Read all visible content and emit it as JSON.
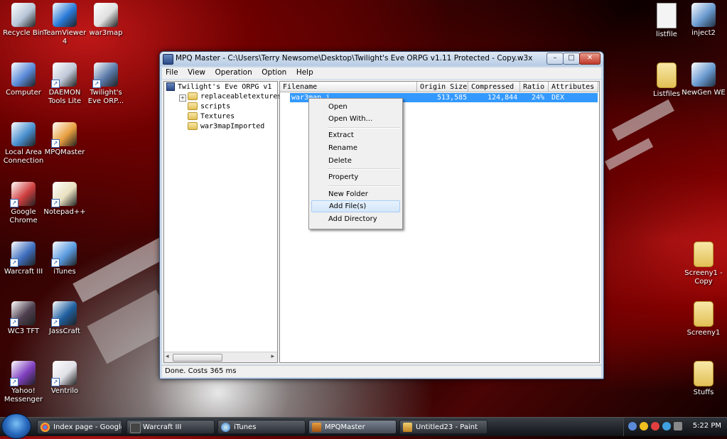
{
  "desktop": {
    "left_icons": [
      {
        "label": "Recycle Bin",
        "icon": "recycle-bin-icon"
      },
      {
        "label": "TeamViewer 4",
        "icon": "teamviewer-icon"
      },
      {
        "label": "war3map",
        "icon": "war3map-file-icon"
      },
      {
        "label": "Computer",
        "icon": "computer-icon"
      },
      {
        "label": "DAEMON Tools Lite",
        "icon": "daemon-tools-icon"
      },
      {
        "label": "Twilight's Eve ORP...",
        "icon": "map-file-icon"
      },
      {
        "label": "Local Area Connection",
        "icon": "network-icon"
      },
      {
        "label": "MPQMaster",
        "icon": "mpqmaster-icon"
      },
      {
        "label": "Google Chrome",
        "icon": "chrome-icon"
      },
      {
        "label": "Notepad++",
        "icon": "notepad-icon"
      },
      {
        "label": "Warcraft III",
        "icon": "warcraft-icon"
      },
      {
        "label": "iTunes",
        "icon": "itunes-icon"
      },
      {
        "label": "WC3 TFT",
        "icon": "wc3tft-icon"
      },
      {
        "label": "JassCraft",
        "icon": "jasscraft-icon"
      },
      {
        "label": "Yahoo! Messenger",
        "icon": "yahoo-icon"
      },
      {
        "label": "Ventrilo",
        "icon": "ventrilo-icon"
      }
    ],
    "right_icons": [
      {
        "label": "listfile",
        "icon": "text-file-icon"
      },
      {
        "label": "inject2",
        "icon": "inject-icon"
      },
      {
        "label": "Listfiles",
        "icon": "folder-icon"
      },
      {
        "label": "NewGen WE",
        "icon": "newgen-icon"
      },
      {
        "label": "Screeny1 - Copy",
        "icon": "folder-icon"
      },
      {
        "label": "Screeny1",
        "icon": "folder-icon"
      },
      {
        "label": "Stuffs",
        "icon": "folder-icon"
      }
    ]
  },
  "window": {
    "title": "MPQ Master - C:\\Users\\Terry Newsome\\Desktop\\Twilight's Eve ORPG v1.11 Protected - Copy.w3x",
    "controls": {
      "minimize": "–",
      "maximize": "□",
      "close": "✕"
    },
    "menu": [
      "File",
      "View",
      "Operation",
      "Option",
      "Help"
    ],
    "tree": {
      "root": "Twilight's Eve ORPG v1",
      "children": [
        "replaceabletextures",
        "scripts",
        "Textures",
        "war3mapImported"
      ],
      "expand_glyph": "+"
    },
    "columns": [
      "Filename",
      "Origin Size",
      "Compressed",
      "Ratio",
      "Attributes"
    ],
    "rows": [
      {
        "filename": "war3map.j",
        "origin_size": "513,585",
        "compressed": "124,844",
        "ratio": "24%",
        "attributes": "DEX"
      }
    ],
    "status": "Done. Costs 365 ms",
    "scroll_left": "◂",
    "scroll_right": "▸"
  },
  "context_menu": {
    "groups": [
      [
        "Open",
        "Open With..."
      ],
      [
        "Extract",
        "Rename",
        "Delete"
      ],
      [
        "Property"
      ],
      [
        "New Folder",
        "Add File(s)",
        "Add Directory"
      ]
    ],
    "highlighted": "Add File(s)"
  },
  "taskbar": {
    "tasks": [
      {
        "label": "Index page - Google...",
        "icon": "chrome-icon"
      },
      {
        "label": "Warcraft III",
        "icon": "warcraft-icon"
      },
      {
        "label": "iTunes",
        "icon": "itunes-icon"
      },
      {
        "label": "MPQMaster",
        "icon": "mpqmaster-icon"
      },
      {
        "label": "Untitled23 - Paint",
        "icon": "paint-icon"
      }
    ],
    "active_task": "MPQMaster",
    "clock": "5:22 PM"
  },
  "colors": {
    "selection": "#3399ff",
    "title_gradient_top": "#dfe9f5",
    "close_button": "#c0392b"
  }
}
